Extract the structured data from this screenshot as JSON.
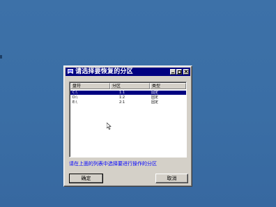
{
  "window": {
    "title": "请选择要恢复的分区"
  },
  "list": {
    "columns": [
      "盘符",
      "分区",
      "类型"
    ],
    "rows": [
      {
        "drive": "C:\\",
        "partition": "1:1",
        "type": "固定"
      },
      {
        "drive": "D:\\",
        "partition": "1:2",
        "type": "固定"
      },
      {
        "drive": "E:\\",
        "partition": "2:1",
        "type": "固定"
      }
    ],
    "selected_index": 0
  },
  "hint": "请在上面的列表中选择要进行操作的分区",
  "buttons": {
    "ok": "确定",
    "cancel": "取消"
  },
  "colors": {
    "desktop": "#3a6ea5",
    "titlebar": "#000080",
    "selection": "#000080",
    "hint_text": "#0000ff"
  },
  "icons": {
    "window_icon": "ghost-app-icon",
    "cursor": "mouse-pointer"
  }
}
